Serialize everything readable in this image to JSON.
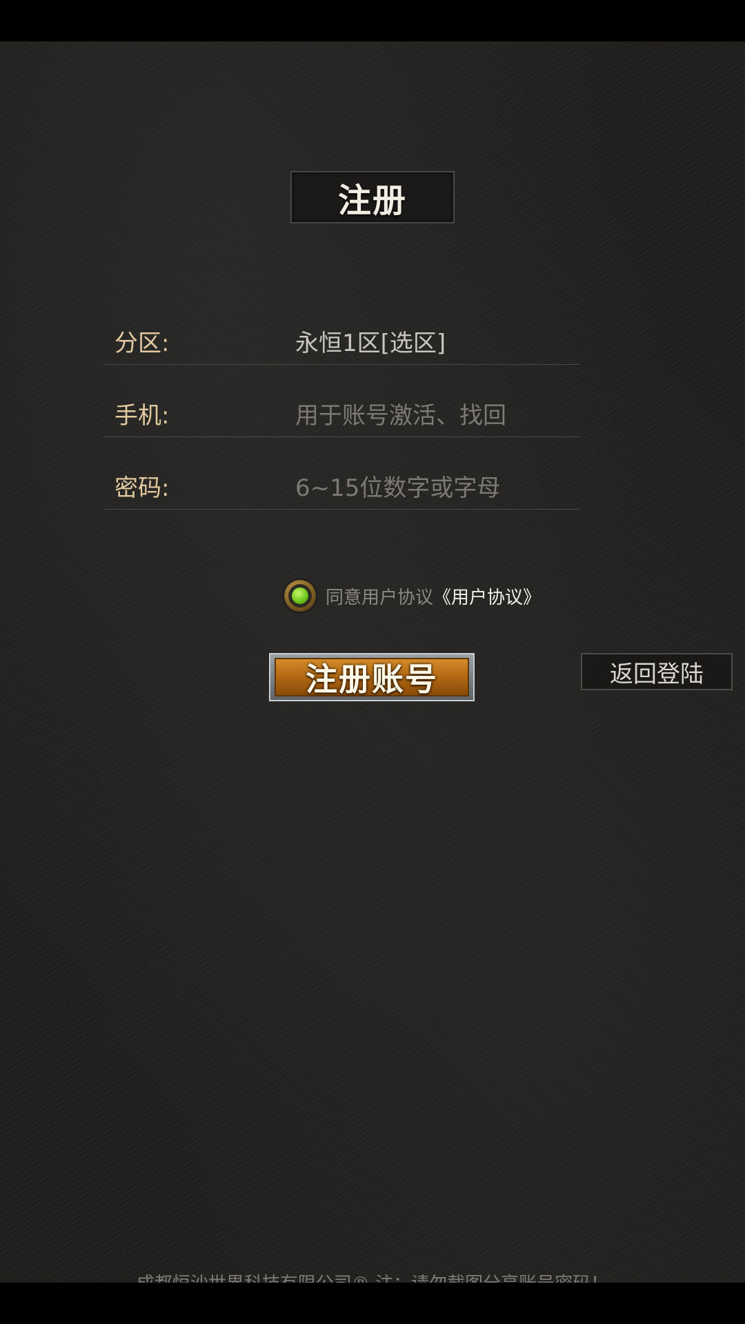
{
  "header": {
    "title": "注册"
  },
  "form": {
    "zone": {
      "label": "分区:",
      "value": "永恒1区[选区]"
    },
    "phone": {
      "label": "手机:",
      "placeholder": "用于账号激活、找回"
    },
    "password": {
      "label": "密码:",
      "placeholder": "6~15位数字或字母"
    }
  },
  "agreement": {
    "checked": true,
    "text": "同意用户协议",
    "link": "《用户协议》"
  },
  "buttons": {
    "register": "注册账号",
    "back_to_login": "返回登陆"
  },
  "footer": {
    "text": "成都恒沙世界科技有限公司® 注：请勿截图分享账号密码！"
  },
  "colors": {
    "label": "#e3c9a0",
    "placeholder": "#7d7a75",
    "register_button": "#b46a14",
    "radio_dot": "#6fc81d"
  }
}
